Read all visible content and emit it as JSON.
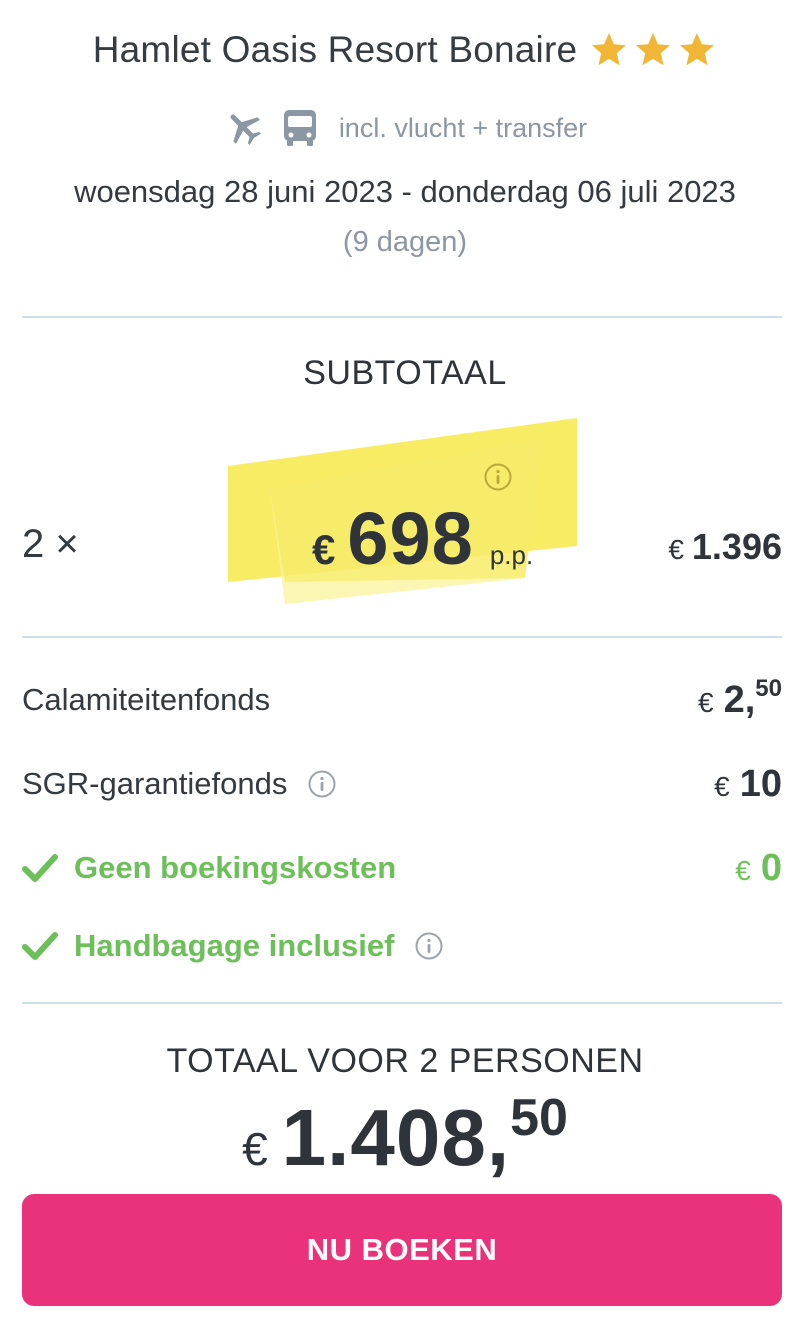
{
  "hotel": {
    "name": "Hamlet Oasis Resort Bonaire",
    "stars": 3,
    "star_color": "#f2b636"
  },
  "transport": {
    "icons": [
      "airplane-icon",
      "bus-icon"
    ],
    "label": "incl. vlucht + transfer"
  },
  "trip": {
    "dates": "woensdag 28 juni 2023 - donderdag 06 juli 2023",
    "duration": "(9 dagen)"
  },
  "subtotal": {
    "heading": "SUBTOTAAL",
    "multiplier": "2 ×",
    "price_currency": "€",
    "price_per_person": "698",
    "price_unit": "p.p.",
    "row_currency": "€",
    "row_total": "1.396",
    "highlight_color": "#f7e94a"
  },
  "fees": [
    {
      "label": "Calamiteitenfonds",
      "currency": "€",
      "int": "2,",
      "dec": "50",
      "info": false,
      "included": false
    },
    {
      "label": "SGR-garantiefonds",
      "currency": "€",
      "int": "10",
      "dec": "",
      "info": true,
      "included": false
    },
    {
      "label": "Geen boekingskosten",
      "currency": "€",
      "int": "0",
      "dec": "",
      "info": false,
      "included": true
    },
    {
      "label": "Handbagage inclusief",
      "currency": "",
      "int": "",
      "dec": "",
      "info": true,
      "included": true
    }
  ],
  "total": {
    "heading": "TOTAAL VOOR 2 PERSONEN",
    "currency": "€",
    "int": "1.408,",
    "dec": "50"
  },
  "book_button": {
    "label": "NU BOEKEN",
    "color": "#ea327a"
  },
  "colors": {
    "green": "#6dbf5a",
    "divider": "#cfdde4",
    "muted": "#8b97a2"
  }
}
